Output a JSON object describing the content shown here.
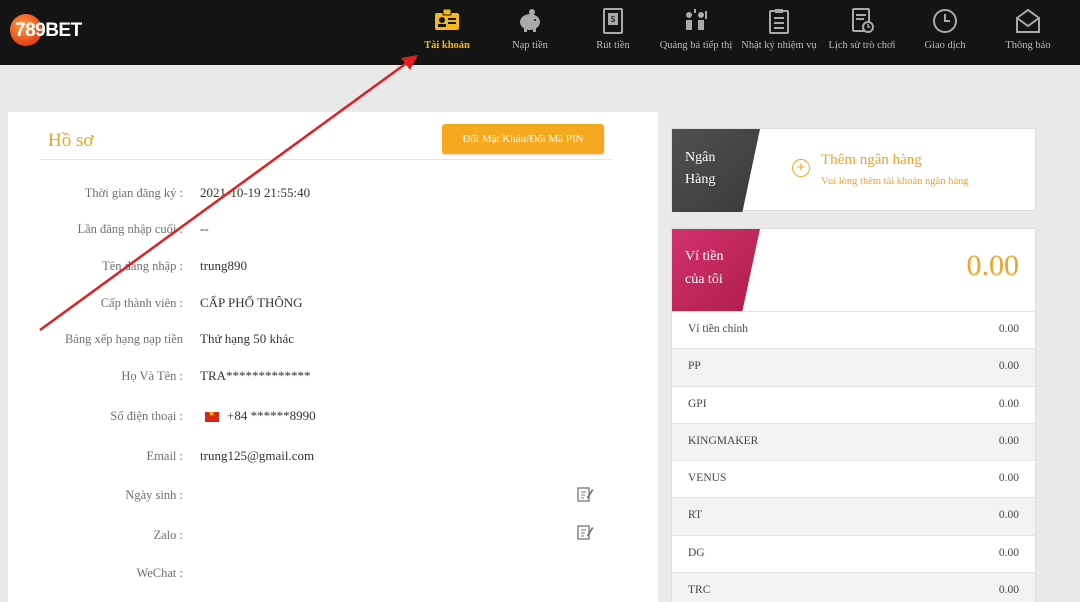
{
  "logo": {
    "text": "789BET"
  },
  "nav": {
    "items": [
      {
        "label": "Tài khoản",
        "icon": "account-card-icon",
        "active": true
      },
      {
        "label": "Nạp tiền",
        "icon": "piggy-bank-icon"
      },
      {
        "label": "Rút tiền",
        "icon": "withdraw-icon"
      },
      {
        "label": "Quảng bá tiếp thị",
        "icon": "promotion-icon"
      },
      {
        "label": "Nhật ký nhiệm vụ",
        "icon": "task-log-icon"
      },
      {
        "label": "Lịch sử trò chơi",
        "icon": "game-history-icon"
      },
      {
        "label": "Giao dịch",
        "icon": "clock-icon"
      },
      {
        "label": "Thông báo",
        "icon": "mail-icon"
      }
    ]
  },
  "profile": {
    "title": "Hồ sơ",
    "change_pin_button": "Đổi Mật Khẩu/Đổi Mã PIN",
    "fields": [
      {
        "label": "Thời gian đăng ký :",
        "value": "2021-10-19 21:55:40"
      },
      {
        "label": "Lần đăng nhập cuối :",
        "value": "--"
      },
      {
        "label": "Tên đăng nhập :",
        "value": "trung890"
      },
      {
        "label": "Cấp thành viên :",
        "value": "CẤP PHỔ THÔNG"
      },
      {
        "label": "Bảng xếp hạng nạp tiền",
        "value": "Thứ hạng 50 khác"
      },
      {
        "label": "Họ Và Tên :",
        "value": "TRA*************"
      },
      {
        "label": "Số điện thoại :",
        "value": "+84  ******8990"
      },
      {
        "label": "Email :",
        "value": "trung125@gmail.com"
      },
      {
        "label": "Ngày sinh :",
        "value": ""
      },
      {
        "label": "Zalo :",
        "value": ""
      },
      {
        "label": "WeChat :",
        "value": ""
      }
    ]
  },
  "bank": {
    "tab_line1": "Ngân",
    "tab_line2": "Hàng",
    "add_title": "Thêm ngân hàng",
    "add_subtitle": "Vui lòng thêm tài khoản ngân hàng"
  },
  "wallet": {
    "tab_line1": "Ví tiền",
    "tab_line2": "của tôi",
    "balance": "0.00",
    "rows": [
      {
        "name": "Ví tiền chính",
        "amount": "0.00"
      },
      {
        "name": "PP",
        "amount": "0.00"
      },
      {
        "name": "GPI",
        "amount": "0.00"
      },
      {
        "name": "KINGMAKER",
        "amount": "0.00"
      },
      {
        "name": "VENUS",
        "amount": "0.00"
      },
      {
        "name": "RT",
        "amount": "0.00"
      },
      {
        "name": "DG",
        "amount": "0.00"
      },
      {
        "name": "TRC",
        "amount": "0.00"
      }
    ]
  },
  "colors": {
    "accent": "#f5a91f",
    "nav_active": "#f5b81b",
    "wallet_tab": "#c8285b",
    "bank_tab": "#474747",
    "annotation_arrow": "#e02020"
  }
}
